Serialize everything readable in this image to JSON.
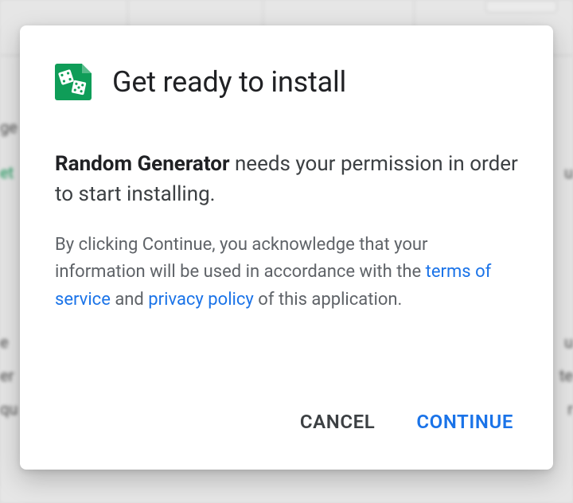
{
  "dialog": {
    "title": "Get ready to install",
    "app_name": "Random Generator",
    "permission_suffix": " needs your permission in order to start installing.",
    "terms_prefix": "By clicking Continue, you acknowledge that your information will be used in accordance with the ",
    "terms_of_service": "terms of service",
    "terms_and": " and ",
    "privacy_policy": "privacy policy",
    "terms_suffix": " of this application.",
    "cancel_label": "CANCEL",
    "continue_label": "CONTINUE"
  },
  "icon": {
    "name": "dice-icon",
    "bg_color": "#0f9d58",
    "fold_color": "#57bb8a"
  },
  "background": {
    "left_fragments": [
      "ge",
      "et",
      "e",
      "er",
      "qu"
    ],
    "right_fragments": [
      "u",
      "u",
      "te",
      "r"
    ]
  }
}
